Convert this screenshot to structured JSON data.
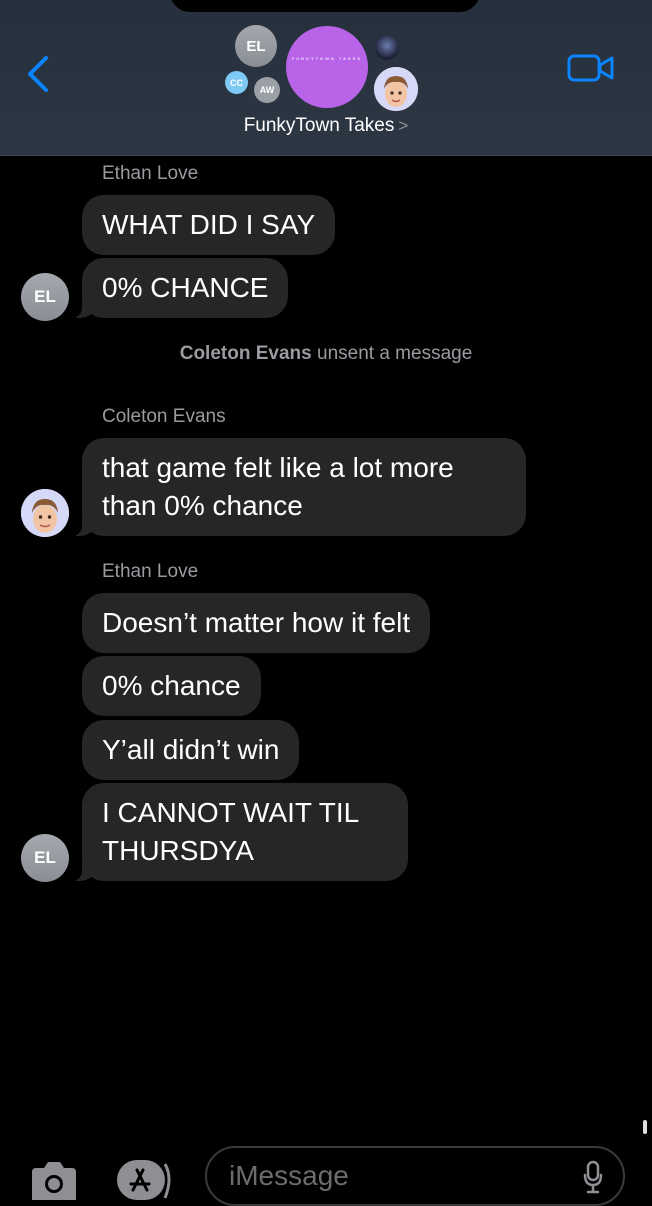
{
  "header": {
    "group_name": "FunkyTown Takes",
    "chevron": ">",
    "participant_initials": [
      "EL",
      "CC",
      "AW"
    ],
    "group_logo_text": "FUNKYTOWN TAKES",
    "accent_color": "#0a84ff",
    "group_avatar_color": "#b964e8"
  },
  "messages": [
    {
      "sender": "Ethan Love",
      "avatar": "EL",
      "texts": [
        "WHAT DID I SAY",
        "0% CHANCE"
      ]
    },
    {
      "system_name": "Coleton Evans",
      "system_text": " unsent a message"
    },
    {
      "sender": "Coleton Evans",
      "avatar": "memoji",
      "texts": [
        "that game felt like a lot more than 0% chance"
      ]
    },
    {
      "sender": "Ethan Love",
      "avatar": "EL",
      "texts": [
        "Doesn’t matter how it felt",
        "0% chance",
        "Y’all didn’t win",
        "I CANNOT WAIT TIL THURSDYA"
      ]
    }
  ],
  "compose": {
    "placeholder": "iMessage",
    "icons": [
      "camera-icon",
      "app-store-icon",
      "microphone-icon"
    ]
  }
}
